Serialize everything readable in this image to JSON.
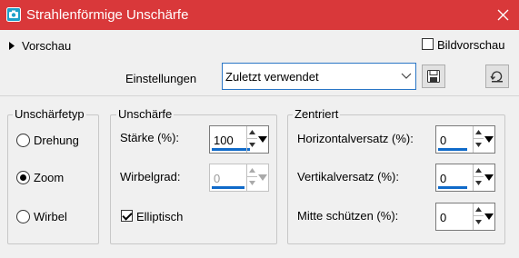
{
  "window": {
    "title": "Strahlenförmige Unschärfe",
    "accent_color": "#d9383a"
  },
  "top": {
    "preview_label": "Vorschau",
    "image_preview_label": "Bildvorschau",
    "image_preview_checked": false,
    "settings_label": "Einstellungen",
    "settings_value": "Zuletzt verwendet",
    "save_icon": "save-icon",
    "reset_icon": "reset-icon"
  },
  "blur_type": {
    "title": "Unschärfetyp",
    "options": [
      "Drehung",
      "Zoom",
      "Wirbel"
    ],
    "selected": "Zoom"
  },
  "blur": {
    "title": "Unschärfe",
    "strength_label": "Stärke (%):",
    "strength_value": "100",
    "twirl_label": "Wirbelgrad:",
    "twirl_value": "0",
    "twirl_enabled": false,
    "elliptical_label": "Elliptisch",
    "elliptical_checked": true
  },
  "center": {
    "title": "Zentriert",
    "h_offset_label": "Horizontalversatz (%):",
    "h_offset_value": "0",
    "v_offset_label": "Vertikalversatz (%):",
    "v_offset_value": "0",
    "protect_label": "Mitte schützen (%):",
    "protect_value": "0"
  }
}
